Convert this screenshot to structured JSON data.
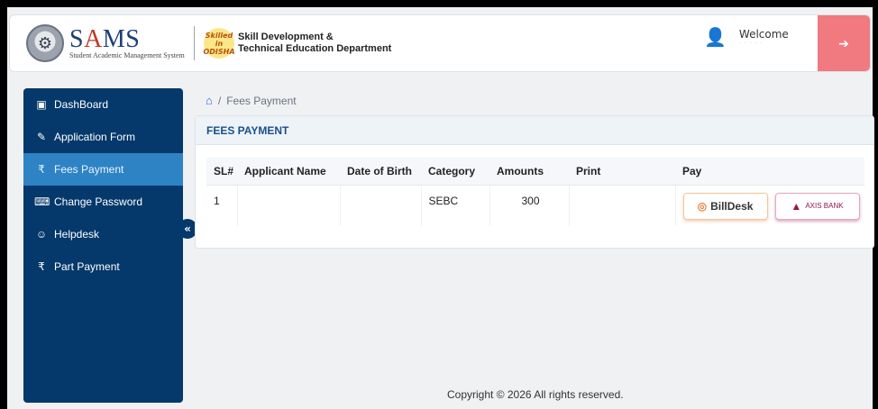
{
  "header": {
    "logo_title": "SAMS",
    "logo_subtitle": "Student Academic Management System",
    "dept_logo_text": "Skilled in ODISHA",
    "dept_line1": "Skill Development &",
    "dept_line2": "Technical Education Department",
    "welcome": "Welcome",
    "welcome_name": "· · · · ·"
  },
  "sidebar": {
    "items": [
      {
        "label": "DashBoard",
        "icon": "monitor-icon"
      },
      {
        "label": "Application Form",
        "icon": "edit-form-icon"
      },
      {
        "label": "Fees Payment",
        "icon": "hand-coin-icon",
        "active": true
      },
      {
        "label": "Change Password",
        "icon": "keyboard-icon"
      },
      {
        "label": "Helpdesk",
        "icon": "helpdesk-icon"
      },
      {
        "label": "Part Payment",
        "icon": "hand-coin-icon"
      }
    ],
    "collapse_glyph": "«"
  },
  "breadcrumb": {
    "separator": "/",
    "current": "Fees Payment"
  },
  "card": {
    "title": "FEES PAYMENT",
    "columns": [
      "SL#",
      "Applicant Name",
      "Date of Birth",
      "Category",
      "Amounts",
      "Print",
      "Pay"
    ],
    "rows": [
      {
        "sl": "1",
        "name": "",
        "dob": "",
        "category": "SEBC",
        "amount": "300",
        "print": ""
      }
    ],
    "pay_options": [
      "BillDesk",
      "AXIS BANK"
    ]
  },
  "footer": "Copyright © 2026 All rights reserved.",
  "colors": {
    "sidebar": "#05386b",
    "active": "#2e83c4",
    "logout": "#f07a80",
    "title": "#1a4f8b"
  }
}
